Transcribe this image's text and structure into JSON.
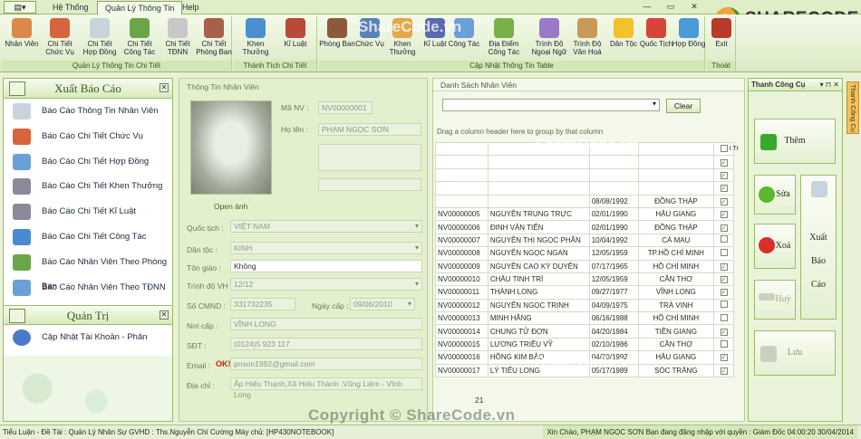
{
  "ribbon_tabs": [
    "Hệ Thống",
    "Quản Lý Thông Tin",
    "Help"
  ],
  "active_tab": "Quản Lý Thông Tin",
  "ribbon_groups": {
    "chi_tiet": {
      "title": "Quản Lý Thông Tin Chi Tiết",
      "buttons": [
        "Nhân Viên",
        "Chi Tiết Chức Vụ",
        "Chi Tiết Hợp Đồng",
        "Chi Tiết Công Tác",
        "Chi Tiết TĐNN",
        "Chi Tiết Phòng Ban"
      ]
    },
    "thanh_tich": {
      "title": "Thành Tích Chi Tiết",
      "buttons": [
        "Khen Thưởng",
        "Kỉ Luật"
      ]
    },
    "cap_nhat": {
      "title": "Cập Nhật Thông Tin Table",
      "buttons": [
        "Phòng Ban",
        "Chức Vụ",
        "Khen Thưởng",
        "Kỉ Luật",
        "Công Tác",
        "Địa Điểm Công Tác",
        "Trình Độ Ngoại Ngữ",
        "Trình Độ Văn Hoá",
        "Dân Tộc",
        "Quốc Tịch",
        "Hợp Đồng"
      ]
    },
    "thoat": {
      "title": "Thoát",
      "buttons": [
        "Exit"
      ]
    }
  },
  "left_panel": {
    "reports_title": "Xuất Báo Cáo",
    "reports": [
      "Báo Cáo Thông Tin Nhân Viên",
      "Báo Cáo Chi Tiết Chức Vụ",
      "Báo Cáo Chi Tiết Hợp Đồng",
      "Báo Cáo  Chi Tiết Khen Thưởng",
      "Báo Cáo Chi Tiết Kỉ Luật",
      "Báo Cáo Chi Tiết Công Tác",
      "Báo Cáo Nhân Viên Theo Phòng Ban",
      "Báo Cáo Nhân Viên Theo TĐNN"
    ],
    "admin_title": "Quản Trị",
    "admin_items": [
      "Cập Nhật Tài Khoản - Phân Quyền"
    ]
  },
  "employee_info": {
    "title": "Thông Tin Nhân Viên",
    "open_image": "Open ảnh",
    "ma_nv_label": "Mã NV :",
    "ma_nv": "NV00000001",
    "ho_ten_label": "Họ tên :",
    "ho_ten": "PHẠM NGỌC SƠN",
    "quoc_tich_label": "Quốc tịch :",
    "quoc_tich": "VIỆT NAM",
    "dan_toc_label": "Dân tộc :",
    "dan_toc": "KINH",
    "ton_giao_label": "Tôn giáo :",
    "ton_giao": "Không",
    "trinh_do_label": "Trình độ VH :",
    "trinh_do": "12/12",
    "cmnd_label": "Số CMND :",
    "cmnd": "331732235",
    "ngay_cap_label": "Ngày cấp :",
    "ngay_cap": "09/06/2010",
    "noi_cap_label": "Nơi cấp :",
    "noi_cap": "VĨNH LONG",
    "sdt_label": "SĐT :",
    "sdt": "(0124)5 923 117",
    "email_label": "Email :",
    "email_badge": "OK!",
    "email": "pnson1992@gmail.com",
    "dia_chi_label": "Địa chỉ :",
    "dia_chi": "Ấp Hiếu Thạnh,Xã Hiếu Thành ,Vũng Liêm - Vĩnh Long"
  },
  "grid": {
    "title": "Danh Sách Nhân Viên",
    "clear": "Clear",
    "group_hint": "Drag a column header here to group by that column",
    "col_last": "I.Tr",
    "rows": [
      {
        "id": "",
        "name": "",
        "dob": "",
        "place": "",
        "check": false
      },
      {
        "id": "",
        "name": "",
        "dob": "",
        "place": "",
        "check": true
      },
      {
        "id": "",
        "name": "",
        "dob": "",
        "place": "",
        "check": true
      },
      {
        "id": "",
        "name": "",
        "dob": "",
        "place": "",
        "check": true
      },
      {
        "id": "",
        "name": "",
        "dob": "08/08/1992",
        "place": "ĐỒNG THÁP",
        "check": true
      },
      {
        "id": "NV00000005",
        "name": "NGUYỄN TRUNG TRỰC",
        "dob": "02/01/1990",
        "place": "HẬU GIANG",
        "check": true
      },
      {
        "id": "NV00000006",
        "name": "ĐINH VĂN TIẾN",
        "dob": "02/01/1990",
        "place": "ĐỒNG THÁP",
        "check": true
      },
      {
        "id": "NV00000007",
        "name": "NGUYỄN THỊ NGỌC PHẤN",
        "dob": "10/04/1992",
        "place": "CÀ MAU",
        "check": false
      },
      {
        "id": "NV00000008",
        "name": "NGUYỄN NGỌC NGAN",
        "dob": "12/05/1959",
        "place": "TP.HỒ CHÍ MINH",
        "check": false
      },
      {
        "id": "NV00000009",
        "name": "NGUYỄN CAO KỲ DUYÊN",
        "dob": "07/17/1965",
        "place": "HỒ CHÍ MINH",
        "check": true
      },
      {
        "id": "NV00000010",
        "name": "CHÂU TINH TRÌ",
        "dob": "12/05/1959",
        "place": "CẦN THƠ",
        "check": true
      },
      {
        "id": "NV00000011",
        "name": "THÀNH LONG",
        "dob": "09/27/1977",
        "place": "VĨNH LONG",
        "check": true
      },
      {
        "id": "NV00000012",
        "name": "NGUYỄN NGỌC TRINH",
        "dob": "04/09/1975",
        "place": "TRÀ VINH",
        "check": false
      },
      {
        "id": "NV00000013",
        "name": "MINH HẰNG",
        "dob": "06/16/1988",
        "place": "HỒ CHÍ MINH",
        "check": false
      },
      {
        "id": "NV00000014",
        "name": "CHUNG TỬ ĐƠN",
        "dob": "04/20/1984",
        "place": "TIỀN GIANG",
        "check": true
      },
      {
        "id": "NV00000015",
        "name": "LƯƠNG TRIỀU VỸ",
        "dob": "02/10/1986",
        "place": "CẦN THƠ",
        "check": false
      },
      {
        "id": "NV00000016",
        "name": "HỒNG KIM BẢO",
        "dob": "04/20/1992",
        "place": "HẬU GIANG",
        "check": true
      },
      {
        "id": "NV00000017",
        "name": "LÝ TIỂU LONG",
        "dob": "05/17/1989",
        "place": "SÓC TRĂNG",
        "check": true
      }
    ],
    "count": "21"
  },
  "right_panel": {
    "title": "Thanh Công Cụ",
    "them": "Thêm",
    "sua": "Sửa",
    "xoa": "Xoá",
    "huy": "Huỷ",
    "luu": "Lưu",
    "xuat_bao_cao": [
      "Xuất",
      "Báo",
      "Cáo"
    ],
    "side_tab": "Thanh Công Cụ"
  },
  "status": {
    "left": "Tiểu Luận - Đề Tài : Quản Lý Nhân Sự  GVHD : Ths.Nguyễn Chí Cường  Máy chủ: [HP430NOTEBOOK]",
    "right": "Xin Chào,  PHẠM NGỌC SƠN  Bạn đang đăng nhập với quyền : Giám Đốc  04:00:20 30/04/2014"
  },
  "watermark": "Copyright © ShareCode.vn",
  "watermark_small": "ShareCode.vn",
  "logo_text": "SHARECODE.VN",
  "colors": {
    "accent": "#9bbb6a",
    "brand": "#3e8f2c",
    "warning": "#f6c25a"
  }
}
